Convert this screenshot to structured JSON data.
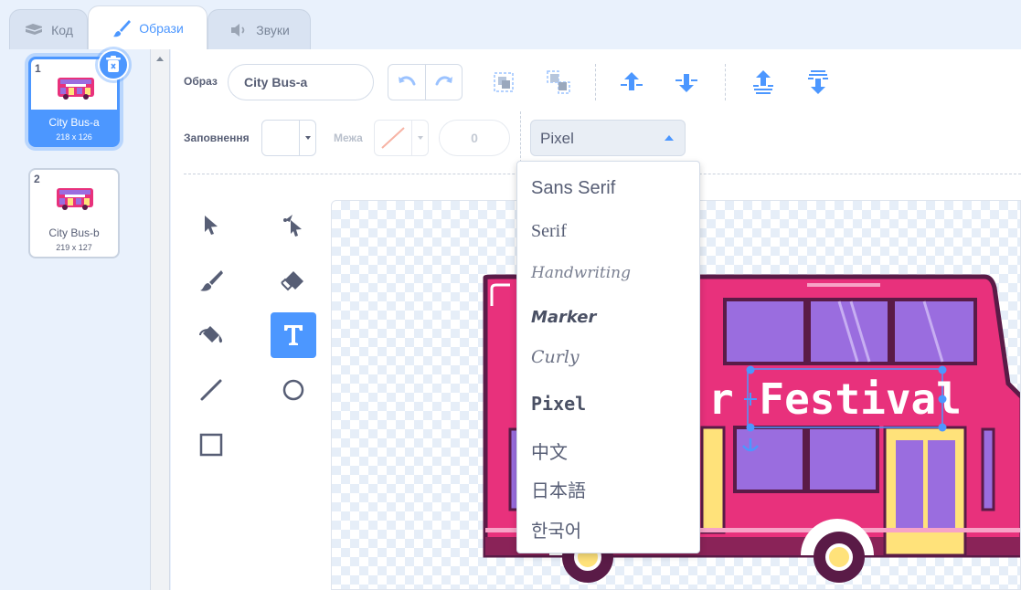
{
  "tabs": [
    {
      "label": "Код",
      "icon": "code-icon"
    },
    {
      "label": "Образи",
      "icon": "paintbrush-icon"
    },
    {
      "label": "Звуки",
      "icon": "speaker-icon"
    }
  ],
  "costumes": [
    {
      "number": "1",
      "name": "City Bus-a",
      "size": "218 x 126",
      "selected": true,
      "thumb_text": "Festival"
    },
    {
      "number": "2",
      "name": "City Bus-b",
      "size": "219 x 127",
      "selected": false,
      "thumb_text": "Festival"
    }
  ],
  "toolbar": {
    "costume_label": "Образ",
    "costume_name": "City Bus-a",
    "fill_label": "Заповнення",
    "fill_color": "#ffffff",
    "outline_label": "Межа",
    "outline_width": "0",
    "font_selected": "Pixel"
  },
  "font_options": [
    "Sans Serif",
    "Serif",
    "Handwriting",
    "Marker",
    "Curly",
    "Pixel",
    "中文",
    "日本語",
    "한국어"
  ],
  "canvas": {
    "text_visible": "r Festival",
    "bus_body_color": "#e8317c",
    "window_color": "#9a6ddf",
    "door_color": "#ffe27a"
  },
  "colors": {
    "accent": "#4c97ff",
    "text": "#575e75"
  }
}
